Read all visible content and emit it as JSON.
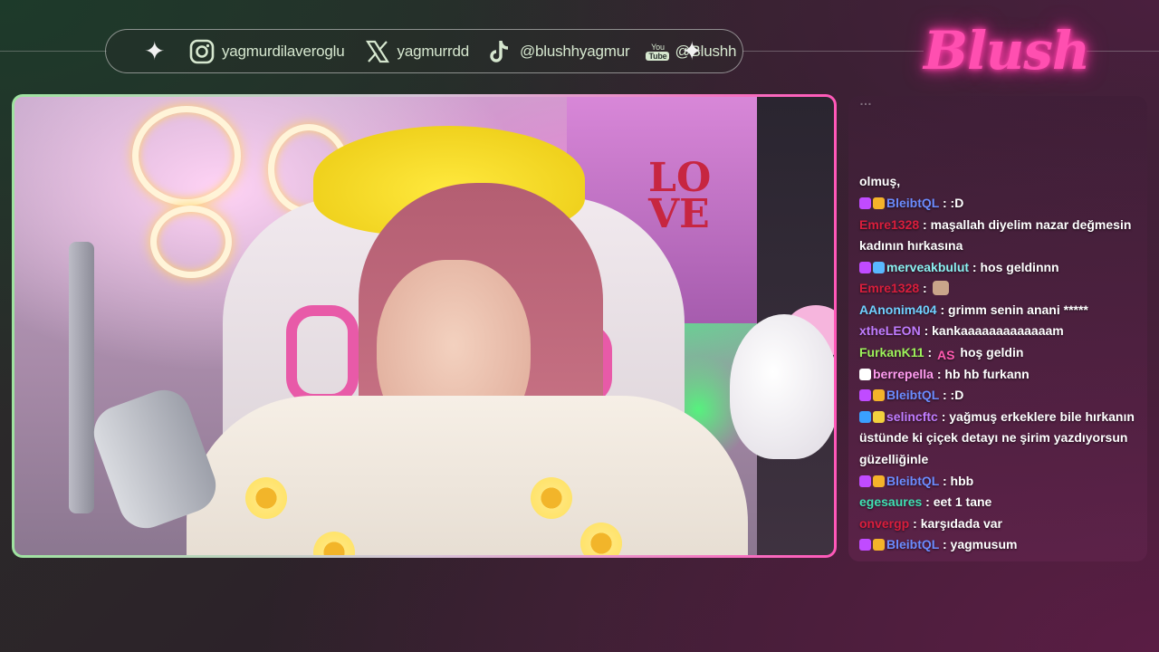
{
  "social": {
    "instagram": "yagmurdilaveroglu",
    "x": "yagmurrdd",
    "tiktok": "@blushhyagmur",
    "youtube_label_top": "You",
    "youtube_label_bottom": "Tube",
    "youtube": "@Blushh"
  },
  "logo": "Blush",
  "colors": {
    "frame_left": "#9fe3a0",
    "frame_right": "#ff57b8",
    "logo_pink": "#ff4fb0"
  },
  "chat": {
    "messages": [
      {
        "user": "",
        "text": "olmuş,",
        "color": "#ffffff",
        "badges": []
      },
      {
        "user": "BleibtQL",
        "text": ":D",
        "color": "#6b8cff",
        "badges": [
          "sub",
          "crown"
        ]
      },
      {
        "user": "Emre1328",
        "text": "maşallah diyelim nazar değmesin kadının hırkasına",
        "color": "#d91e3c",
        "badges": []
      },
      {
        "user": "merveakbulut",
        "text": "hos geldinnn",
        "color": "#8af0f0",
        "badges": [
          "sub",
          "gift"
        ]
      },
      {
        "user": "Emre1328",
        "text": "",
        "color": "#d91e3c",
        "badges": [],
        "emote": "cat-emote"
      },
      {
        "user": "AAnonim404",
        "text": "grimm senin anani *****",
        "color": "#6fd0ff",
        "badges": []
      },
      {
        "user": "xtheLEON",
        "text": "kankaaaaaaaaaaaaam",
        "color": "#c07cff",
        "badges": []
      },
      {
        "user": "FurkanK11",
        "text": "hoş geldin",
        "color": "#9df25a",
        "badges": [],
        "emote": "AS"
      },
      {
        "user": "berrepella",
        "text": "hb hb furkann",
        "color": "#ff9cf0",
        "badges": [
          "bot"
        ]
      },
      {
        "user": "BleibtQL",
        "text": ":D",
        "color": "#6b8cff",
        "badges": [
          "sub",
          "crown"
        ]
      },
      {
        "user": "selincftc",
        "text": "yağmuş erkeklere bile hırkanın üstünde ki çiçek detayı ne şirim yazdıyorsun güzelliğinle",
        "color": "#c07cff",
        "badges": [
          "cube",
          "smile"
        ]
      },
      {
        "user": "BleibtQL",
        "text": "hbb",
        "color": "#6b8cff",
        "badges": [
          "sub",
          "crown"
        ]
      },
      {
        "user": "egesaures",
        "text": "eet 1 tane",
        "color": "#3fe0b2",
        "badges": []
      },
      {
        "user": "onvergp",
        "text": "karşıdada var",
        "color": "#d91e3c",
        "badges": []
      },
      {
        "user": "BleibtQL",
        "text": "yagmusum",
        "color": "#6b8cff",
        "badges": [
          "sub",
          "crown"
        ]
      }
    ]
  }
}
